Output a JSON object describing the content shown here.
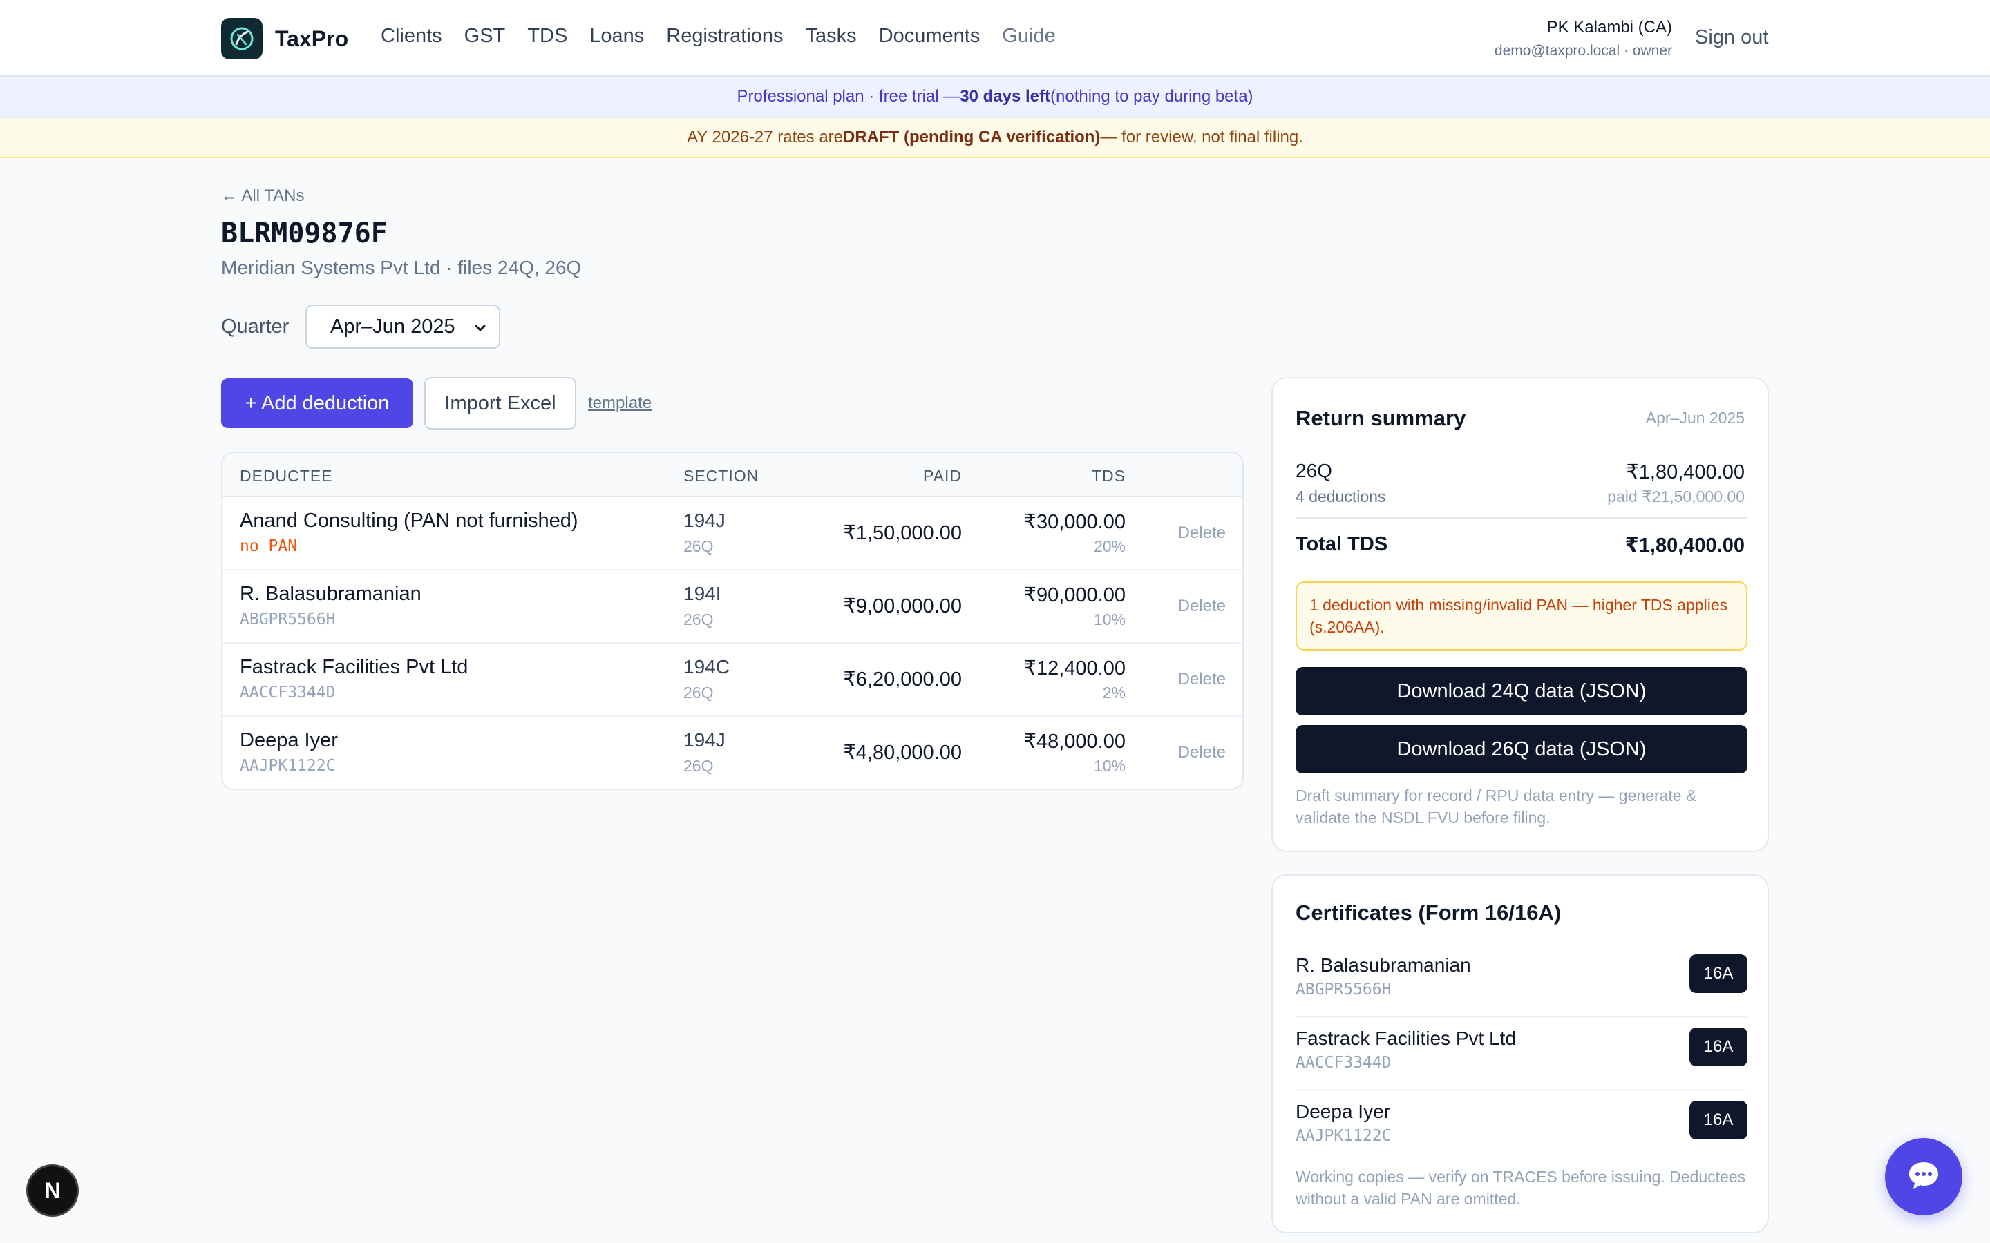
{
  "app": {
    "name": "TaxPro"
  },
  "nav": {
    "items": [
      {
        "label": "Clients"
      },
      {
        "label": "GST"
      },
      {
        "label": "TDS"
      },
      {
        "label": "Loans"
      },
      {
        "label": "Registrations"
      },
      {
        "label": "Tasks"
      },
      {
        "label": "Documents"
      },
      {
        "label": "Guide"
      }
    ]
  },
  "user": {
    "name": "PK Kalambi (CA)",
    "email_role": "demo@taxpro.local · owner",
    "signout": "Sign out"
  },
  "plan_banner": {
    "prefix": "Professional plan · free trial — ",
    "days": "30 days left",
    "suffix": " (nothing to pay during beta)"
  },
  "draft_banner": {
    "prefix": "AY 2026-27 rates are ",
    "bold": "DRAFT (pending CA verification)",
    "suffix": " — for review, not final filing."
  },
  "page": {
    "back": "← All TANs",
    "tan": "BLRM09876F",
    "subtitle": "Meridian Systems Pvt Ltd · files 24Q, 26Q",
    "quarter_label": "Quarter",
    "quarter_value": "Apr–Jun 2025"
  },
  "actions": {
    "add": "+ Add deduction",
    "import": "Import Excel",
    "template": "template"
  },
  "table": {
    "headers": {
      "deductee": "DEDUCTEE",
      "section": "SECTION",
      "paid": "PAID",
      "tds": "TDS"
    },
    "rows": [
      {
        "name": "Anand Consulting (PAN not furnished)",
        "pan": "no PAN",
        "section": "194J",
        "form": "26Q",
        "paid": "₹1,50,000.00",
        "tds": "₹30,000.00",
        "rate": "20%",
        "delete": "Delete"
      },
      {
        "name": "R. Balasubramanian",
        "pan": "ABGPR5566H",
        "section": "194I",
        "form": "26Q",
        "paid": "₹9,00,000.00",
        "tds": "₹90,000.00",
        "rate": "10%",
        "delete": "Delete"
      },
      {
        "name": "Fastrack Facilities Pvt Ltd",
        "pan": "AACCF3344D",
        "section": "194C",
        "form": "26Q",
        "paid": "₹6,20,000.00",
        "tds": "₹12,400.00",
        "rate": "2%",
        "delete": "Delete"
      },
      {
        "name": "Deepa Iyer",
        "pan": "AAJPK1122C",
        "section": "194J",
        "form": "26Q",
        "paid": "₹4,80,000.00",
        "tds": "₹48,000.00",
        "rate": "10%",
        "delete": "Delete"
      }
    ]
  },
  "summary": {
    "title": "Return summary",
    "quarter": "Apr–Jun 2025",
    "form": "26Q",
    "count": "4 deductions",
    "amount": "₹1,80,400.00",
    "paid": "paid ₹21,50,000.00",
    "total_label": "Total TDS",
    "total": "₹1,80,400.00",
    "warning": "1 deduction with missing/invalid PAN — higher TDS applies (s.206AA).",
    "download_24q": "Download 24Q data (JSON)",
    "download_26q": "Download 26Q data (JSON)",
    "note": "Draft summary for record / RPU data entry — generate & validate the NSDL FVU before filing."
  },
  "certificates": {
    "title": "Certificates (Form 16/16A)",
    "items": [
      {
        "name": "R. Balasubramanian",
        "pan": "ABGPR5566H",
        "badge": "16A"
      },
      {
        "name": "Fastrack Facilities Pvt Ltd",
        "pan": "AACCF3344D",
        "badge": "16A"
      },
      {
        "name": "Deepa Iyer",
        "pan": "AAJPK1122C",
        "badge": "16A"
      }
    ],
    "note": "Working copies — verify on TRACES before issuing. Deductees without a valid PAN are omitted."
  },
  "dev_badge": "N",
  "colors": {
    "accent": "#4f46e5",
    "dark": "#0f172a",
    "warning": "#c2410c"
  }
}
